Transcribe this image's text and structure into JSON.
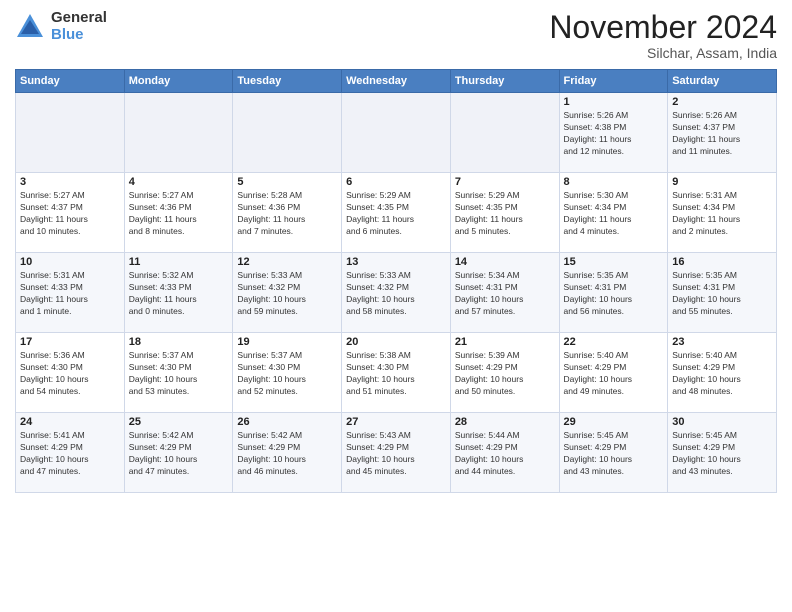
{
  "logo": {
    "general": "General",
    "blue": "Blue"
  },
  "header": {
    "month": "November 2024",
    "location": "Silchar, Assam, India"
  },
  "weekdays": [
    "Sunday",
    "Monday",
    "Tuesday",
    "Wednesday",
    "Thursday",
    "Friday",
    "Saturday"
  ],
  "weeks": [
    [
      {
        "day": "",
        "info": ""
      },
      {
        "day": "",
        "info": ""
      },
      {
        "day": "",
        "info": ""
      },
      {
        "day": "",
        "info": ""
      },
      {
        "day": "",
        "info": ""
      },
      {
        "day": "1",
        "info": "Sunrise: 5:26 AM\nSunset: 4:38 PM\nDaylight: 11 hours\nand 12 minutes."
      },
      {
        "day": "2",
        "info": "Sunrise: 5:26 AM\nSunset: 4:37 PM\nDaylight: 11 hours\nand 11 minutes."
      }
    ],
    [
      {
        "day": "3",
        "info": "Sunrise: 5:27 AM\nSunset: 4:37 PM\nDaylight: 11 hours\nand 10 minutes."
      },
      {
        "day": "4",
        "info": "Sunrise: 5:27 AM\nSunset: 4:36 PM\nDaylight: 11 hours\nand 8 minutes."
      },
      {
        "day": "5",
        "info": "Sunrise: 5:28 AM\nSunset: 4:36 PM\nDaylight: 11 hours\nand 7 minutes."
      },
      {
        "day": "6",
        "info": "Sunrise: 5:29 AM\nSunset: 4:35 PM\nDaylight: 11 hours\nand 6 minutes."
      },
      {
        "day": "7",
        "info": "Sunrise: 5:29 AM\nSunset: 4:35 PM\nDaylight: 11 hours\nand 5 minutes."
      },
      {
        "day": "8",
        "info": "Sunrise: 5:30 AM\nSunset: 4:34 PM\nDaylight: 11 hours\nand 4 minutes."
      },
      {
        "day": "9",
        "info": "Sunrise: 5:31 AM\nSunset: 4:34 PM\nDaylight: 11 hours\nand 2 minutes."
      }
    ],
    [
      {
        "day": "10",
        "info": "Sunrise: 5:31 AM\nSunset: 4:33 PM\nDaylight: 11 hours\nand 1 minute."
      },
      {
        "day": "11",
        "info": "Sunrise: 5:32 AM\nSunset: 4:33 PM\nDaylight: 11 hours\nand 0 minutes."
      },
      {
        "day": "12",
        "info": "Sunrise: 5:33 AM\nSunset: 4:32 PM\nDaylight: 10 hours\nand 59 minutes."
      },
      {
        "day": "13",
        "info": "Sunrise: 5:33 AM\nSunset: 4:32 PM\nDaylight: 10 hours\nand 58 minutes."
      },
      {
        "day": "14",
        "info": "Sunrise: 5:34 AM\nSunset: 4:31 PM\nDaylight: 10 hours\nand 57 minutes."
      },
      {
        "day": "15",
        "info": "Sunrise: 5:35 AM\nSunset: 4:31 PM\nDaylight: 10 hours\nand 56 minutes."
      },
      {
        "day": "16",
        "info": "Sunrise: 5:35 AM\nSunset: 4:31 PM\nDaylight: 10 hours\nand 55 minutes."
      }
    ],
    [
      {
        "day": "17",
        "info": "Sunrise: 5:36 AM\nSunset: 4:30 PM\nDaylight: 10 hours\nand 54 minutes."
      },
      {
        "day": "18",
        "info": "Sunrise: 5:37 AM\nSunset: 4:30 PM\nDaylight: 10 hours\nand 53 minutes."
      },
      {
        "day": "19",
        "info": "Sunrise: 5:37 AM\nSunset: 4:30 PM\nDaylight: 10 hours\nand 52 minutes."
      },
      {
        "day": "20",
        "info": "Sunrise: 5:38 AM\nSunset: 4:30 PM\nDaylight: 10 hours\nand 51 minutes."
      },
      {
        "day": "21",
        "info": "Sunrise: 5:39 AM\nSunset: 4:29 PM\nDaylight: 10 hours\nand 50 minutes."
      },
      {
        "day": "22",
        "info": "Sunrise: 5:40 AM\nSunset: 4:29 PM\nDaylight: 10 hours\nand 49 minutes."
      },
      {
        "day": "23",
        "info": "Sunrise: 5:40 AM\nSunset: 4:29 PM\nDaylight: 10 hours\nand 48 minutes."
      }
    ],
    [
      {
        "day": "24",
        "info": "Sunrise: 5:41 AM\nSunset: 4:29 PM\nDaylight: 10 hours\nand 47 minutes."
      },
      {
        "day": "25",
        "info": "Sunrise: 5:42 AM\nSunset: 4:29 PM\nDaylight: 10 hours\nand 47 minutes."
      },
      {
        "day": "26",
        "info": "Sunrise: 5:42 AM\nSunset: 4:29 PM\nDaylight: 10 hours\nand 46 minutes."
      },
      {
        "day": "27",
        "info": "Sunrise: 5:43 AM\nSunset: 4:29 PM\nDaylight: 10 hours\nand 45 minutes."
      },
      {
        "day": "28",
        "info": "Sunrise: 5:44 AM\nSunset: 4:29 PM\nDaylight: 10 hours\nand 44 minutes."
      },
      {
        "day": "29",
        "info": "Sunrise: 5:45 AM\nSunset: 4:29 PM\nDaylight: 10 hours\nand 43 minutes."
      },
      {
        "day": "30",
        "info": "Sunrise: 5:45 AM\nSunset: 4:29 PM\nDaylight: 10 hours\nand 43 minutes."
      }
    ]
  ]
}
